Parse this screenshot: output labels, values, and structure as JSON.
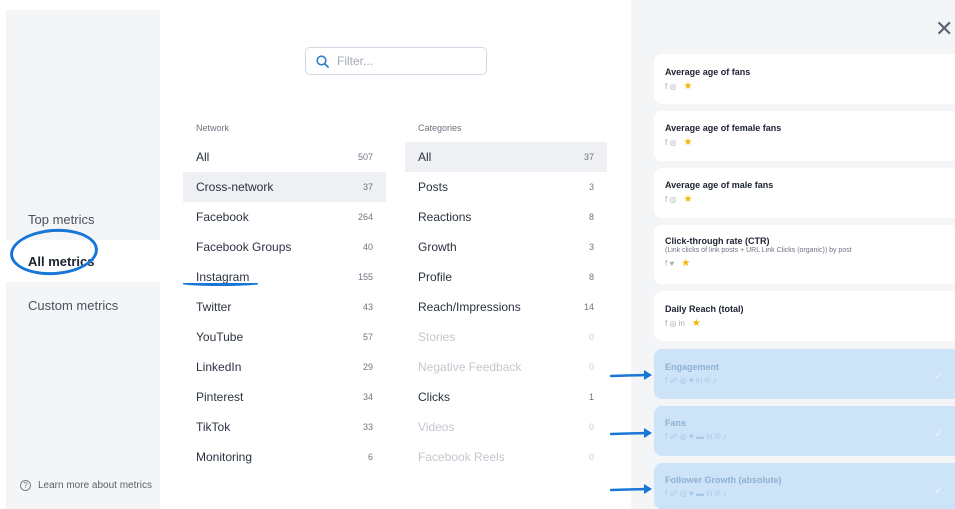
{
  "left_nav": {
    "items": [
      {
        "label": "Top metrics"
      },
      {
        "label": "All metrics"
      },
      {
        "label": "Custom metrics"
      }
    ],
    "learn_more": "Learn more about metrics"
  },
  "filter": {
    "placeholder": "Filter..."
  },
  "network": {
    "header": "Network",
    "rows": [
      {
        "label": "All",
        "count": "507"
      },
      {
        "label": "Cross-network",
        "count": "37"
      },
      {
        "label": "Facebook",
        "count": "264"
      },
      {
        "label": "Facebook Groups",
        "count": "40"
      },
      {
        "label": "Instagram",
        "count": "155"
      },
      {
        "label": "Twitter",
        "count": "43"
      },
      {
        "label": "YouTube",
        "count": "57"
      },
      {
        "label": "LinkedIn",
        "count": "29"
      },
      {
        "label": "Pinterest",
        "count": "34"
      },
      {
        "label": "TikTok",
        "count": "33"
      },
      {
        "label": "Monitoring",
        "count": "6"
      }
    ]
  },
  "categories": {
    "header": "Categories",
    "rows": [
      {
        "label": "All",
        "count": "37"
      },
      {
        "label": "Posts",
        "count": "3"
      },
      {
        "label": "Reactions",
        "count": "8"
      },
      {
        "label": "Growth",
        "count": "3"
      },
      {
        "label": "Profile",
        "count": "8"
      },
      {
        "label": "Reach/Impressions",
        "count": "14"
      },
      {
        "label": "Stories",
        "count": "0"
      },
      {
        "label": "Negative Feedback",
        "count": "0"
      },
      {
        "label": "Clicks",
        "count": "1"
      },
      {
        "label": "Videos",
        "count": "0"
      },
      {
        "label": "Facebook Reels",
        "count": "0"
      }
    ]
  },
  "metrics": [
    {
      "title": "Average age of fans",
      "icons": "f  ◎"
    },
    {
      "title": "Average age of female fans",
      "icons": "f  ◎"
    },
    {
      "title": "Average age of male fans",
      "icons": "f  ◎"
    },
    {
      "title": "Click-through rate (CTR)",
      "subtitle": "(Link clicks of link posts + URL Link Clicks (organic)) by post",
      "icons": "f  ♥"
    },
    {
      "title": "Daily Reach (total)",
      "icons": "f  ◎  in"
    },
    {
      "title": "Engagement",
      "icons": "f  ☍  ◎  ♥  in  ℗  ♪"
    },
    {
      "title": "Fans",
      "icons": "f  ☍  ◎  ♥  ▬  in  ℗  ♪"
    },
    {
      "title": "Follower Growth (absolute)",
      "icons": "f  ☍  ◎  ♥  ▬  in  ℗  ♪"
    }
  ],
  "colors": {
    "accent": "#1877d6",
    "selected_card": "#cde3f7",
    "star": "#f5b700"
  }
}
